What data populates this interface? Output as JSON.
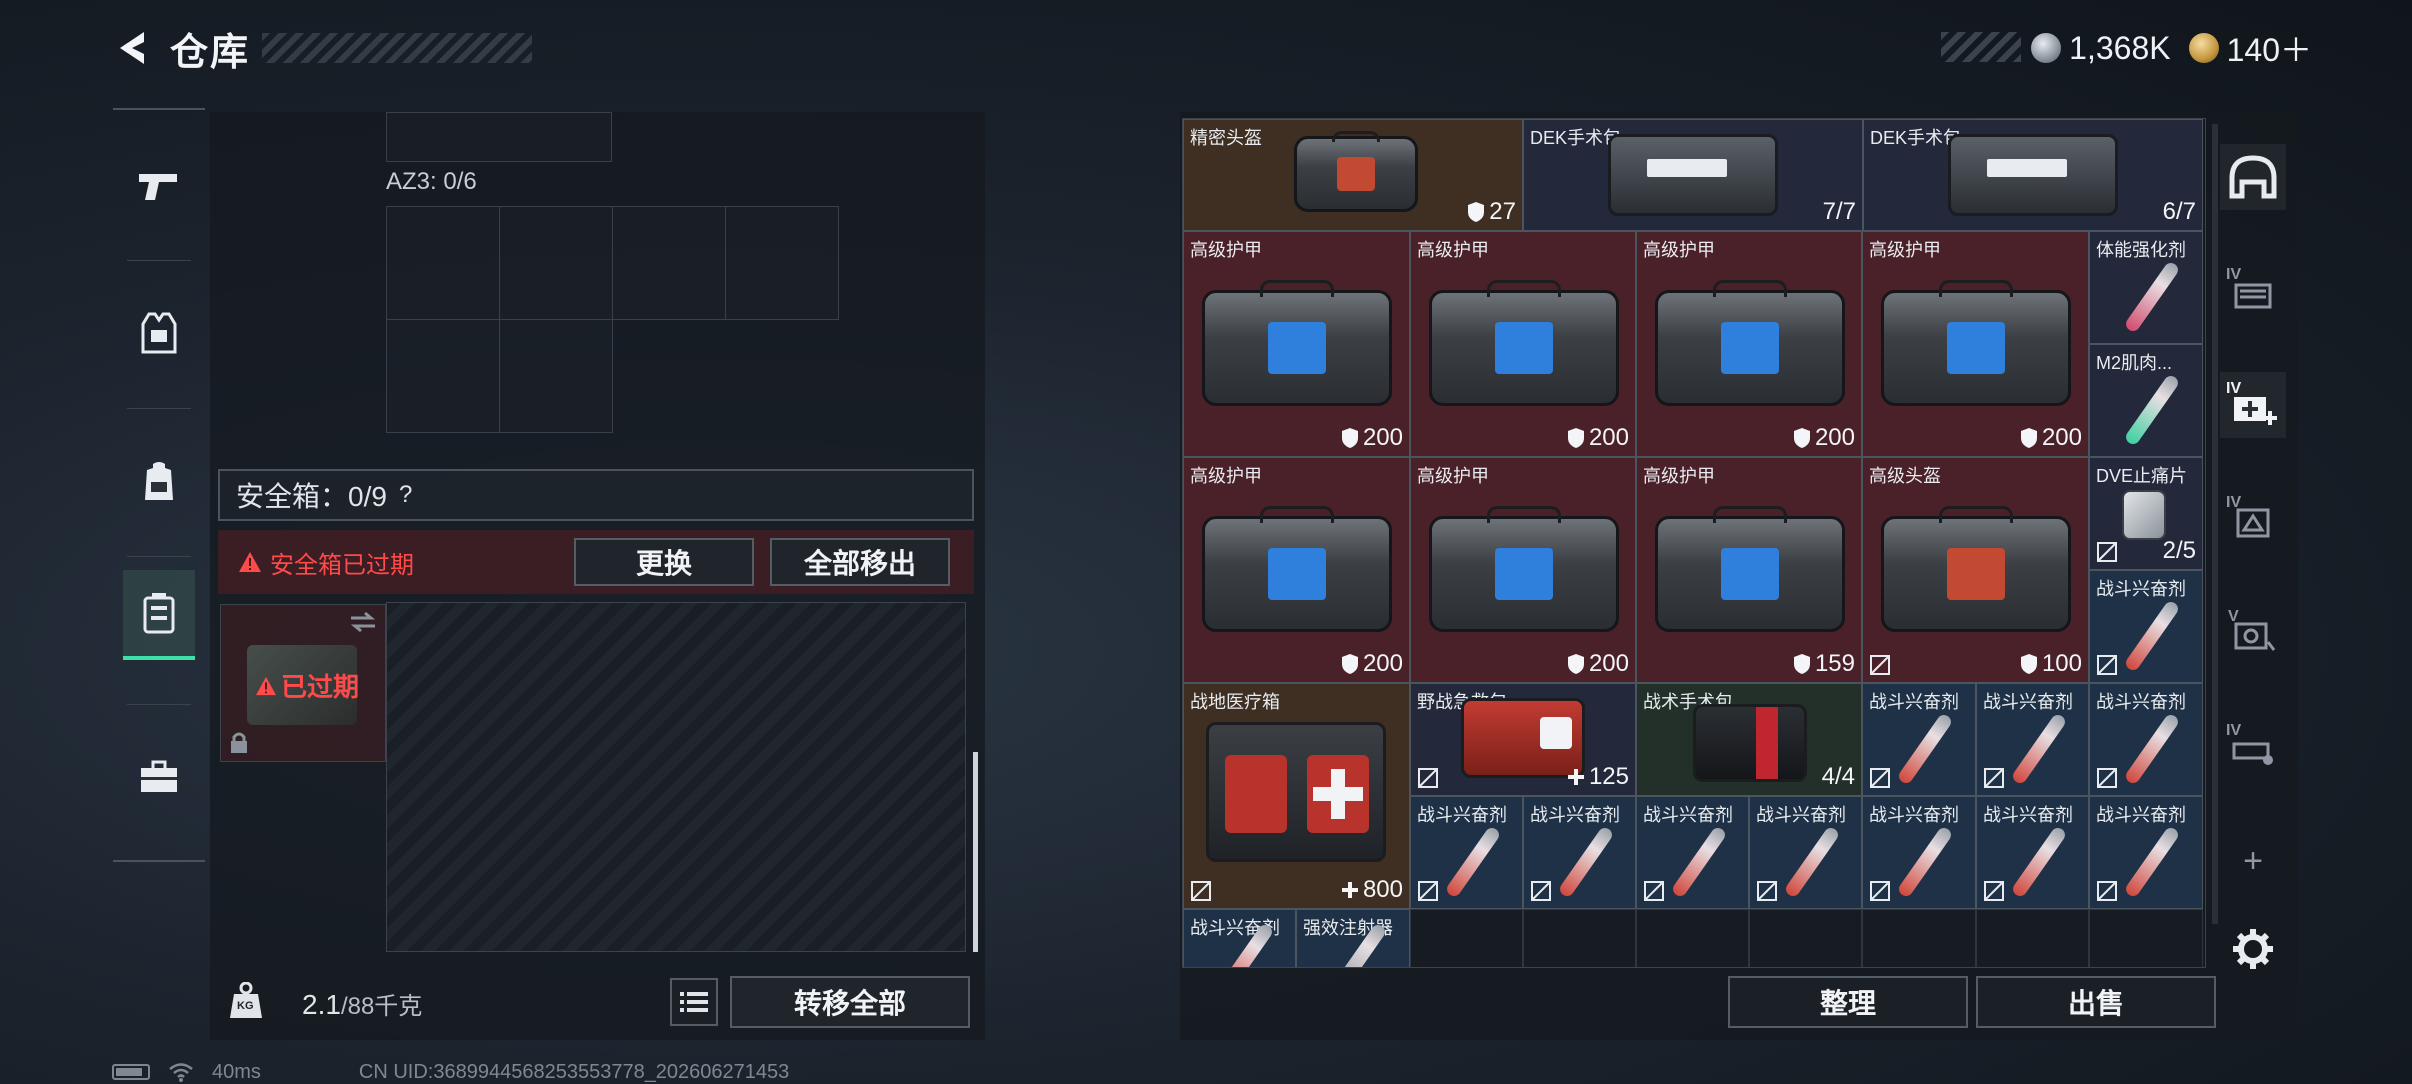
{
  "header": {
    "title": "仓库",
    "currency": [
      {
        "icon": "silver-coin-icon",
        "value": "1,368K"
      },
      {
        "icon": "gold-coin-icon",
        "value": "140＋"
      }
    ]
  },
  "categories": [
    {
      "icon": "pistol-icon",
      "active": false
    },
    {
      "icon": "armor-vest-icon",
      "active": false
    },
    {
      "icon": "backpack-icon",
      "active": false
    },
    {
      "icon": "safebox-icon",
      "active": true
    },
    {
      "icon": "toolbox-icon",
      "active": false
    }
  ],
  "storage": {
    "az3_label": "AZ3: 0/6",
    "safebox_label": "安全箱：0/9",
    "help": "?",
    "expired_warning": "安全箱已过期",
    "replace_button": "更换",
    "move_all_out_button": "全部移出",
    "safebox_expired_tag": "已过期",
    "weight_value": "2.1",
    "weight_unit": "/88千克",
    "weight_icon_label": "KG",
    "transfer_all_button": "转移全部"
  },
  "inventory": {
    "items": [
      {
        "name": "精密头盔",
        "count": "27",
        "shield": true
      },
      {
        "name": "DEK手术包",
        "count": "7/7"
      },
      {
        "name": "DEK手术包",
        "count": "6/7"
      },
      {
        "name": "高级护甲",
        "count": "200",
        "shield": true
      },
      {
        "name": "高级护甲",
        "count": "200",
        "shield": true
      },
      {
        "name": "高级护甲",
        "count": "200",
        "shield": true
      },
      {
        "name": "高级护甲",
        "count": "200",
        "shield": true
      },
      {
        "name": "体能强化剂",
        "count": ""
      },
      {
        "name": "M2肌肉...",
        "count": ""
      },
      {
        "name": "高级护甲",
        "count": "200",
        "shield": true
      },
      {
        "name": "高级护甲",
        "count": "200",
        "shield": true
      },
      {
        "name": "高级护甲",
        "count": "159",
        "shield": true
      },
      {
        "name": "高级头盔",
        "count": "100",
        "shield": true
      },
      {
        "name": "DVE止痛片",
        "count": "2/5"
      },
      {
        "name": "战斗兴奋剂",
        "count": ""
      },
      {
        "name": "战地医疗箱",
        "count": "800",
        "plus": true
      },
      {
        "name": "野战急救包",
        "count": "125",
        "plus": true
      },
      {
        "name": "战术手术包",
        "count": "4/4"
      },
      {
        "name": "战斗兴奋剂",
        "count": ""
      },
      {
        "name": "战斗兴奋剂",
        "count": ""
      },
      {
        "name": "战斗兴奋剂",
        "count": ""
      },
      {
        "name": "战斗兴奋剂",
        "count": ""
      },
      {
        "name": "战斗兴奋剂",
        "count": ""
      },
      {
        "name": "战斗兴奋剂",
        "count": ""
      },
      {
        "name": "战斗兴奋剂",
        "count": ""
      },
      {
        "name": "战斗兴奋剂",
        "count": ""
      },
      {
        "name": "战斗兴奋剂",
        "count": ""
      },
      {
        "name": "战斗兴奋剂",
        "count": ""
      },
      {
        "name": "战斗兴奋剂",
        "count": ""
      },
      {
        "name": "强效注射器",
        "count": ""
      }
    ],
    "sort_button": "整理",
    "sell_button": "出售"
  },
  "tools": [
    {
      "icon": "helmet-filter-icon"
    },
    {
      "icon": "iv-container-icon",
      "badge": "IV"
    },
    {
      "icon": "iv-medkit-icon",
      "badge": "IV"
    },
    {
      "icon": "iv-armor-icon",
      "badge": "IV"
    },
    {
      "icon": "v-safe-icon",
      "badge": "V"
    },
    {
      "icon": "iv-vehicle-icon",
      "badge": "IV"
    },
    {
      "icon": "add-icon",
      "label": "+"
    },
    {
      "icon": "settings-gear-icon"
    }
  ],
  "status": {
    "ping": "40ms",
    "uid": "CN UID:3689944568253553778_202606271453"
  }
}
